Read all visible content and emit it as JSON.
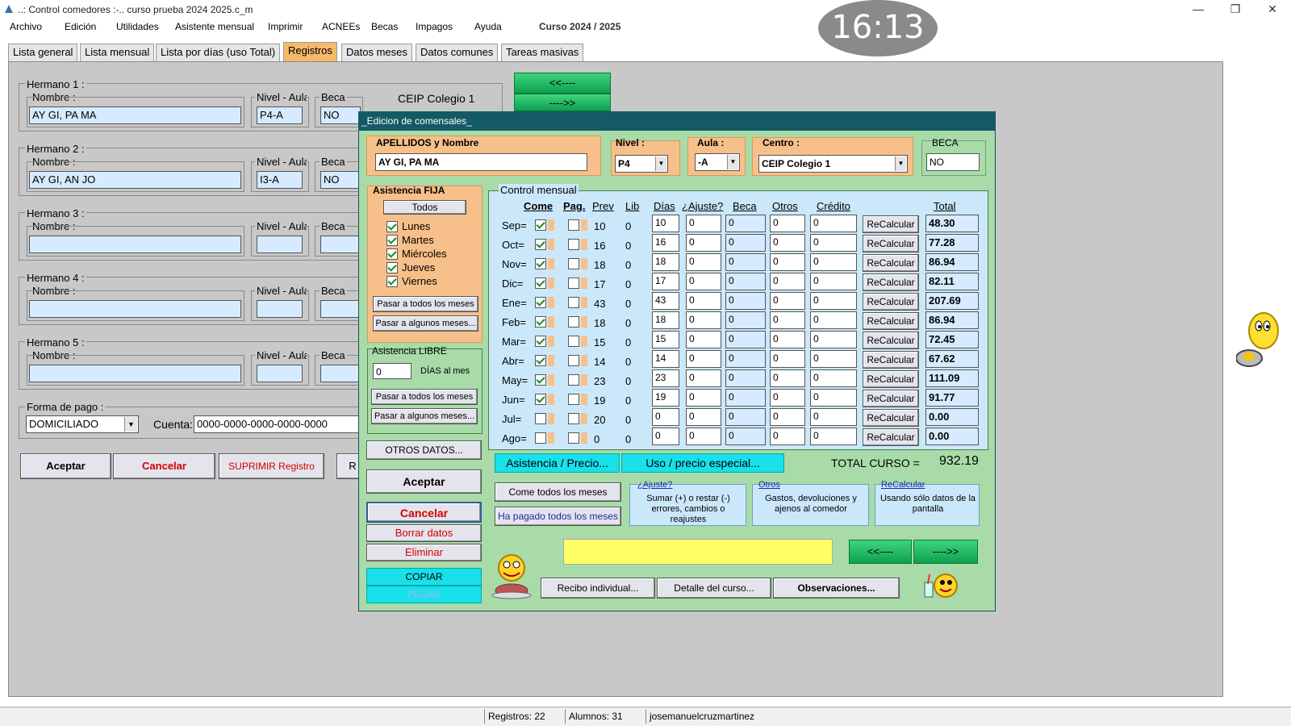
{
  "window": {
    "title": "..: Control comedores :-..   curso prueba 2024 2025.c_m",
    "min": "—",
    "max": "❐",
    "close": "✕"
  },
  "menu": [
    "Archivo",
    "Edición",
    "Utilidades",
    "Asistente mensual",
    "Imprimir",
    "ACNEEs",
    "Becas",
    "Impagos",
    "Ayuda"
  ],
  "curso": "Curso 2024 / 2025",
  "clock": "16:13",
  "tabs": [
    "Lista general",
    "Lista mensual",
    "Lista por días (uso Total)",
    "Registros",
    "Datos meses",
    "Datos comunes",
    "Tareas masivas"
  ],
  "main": {
    "hermanos": [
      {
        "label": "Hermano 1 :",
        "nombre_label": "Nombre :",
        "nombre": "AY GI, PA MA",
        "nivel_label": "Nivel - Aula",
        "nivel": "P4-A",
        "beca_label": "Beca",
        "beca": "NO"
      },
      {
        "label": "Hermano 2 :",
        "nombre_label": "Nombre :",
        "nombre": "AY GI, AN JO",
        "nivel_label": "Nivel - Aula",
        "nivel": "I3-A",
        "beca_label": "Beca",
        "beca": "NO"
      },
      {
        "label": "Hermano 3 :",
        "nombre_label": "Nombre :",
        "nombre": "",
        "nivel_label": "Nivel - Aula",
        "nivel": "",
        "beca_label": "Beca",
        "beca": ""
      },
      {
        "label": "Hermano 4 :",
        "nombre_label": "Nombre :",
        "nombre": "",
        "nivel_label": "Nivel - Aula",
        "nivel": "",
        "beca_label": "Beca",
        "beca": ""
      },
      {
        "label": "Hermano 5 :",
        "nombre_label": "Nombre :",
        "nombre": "",
        "nivel_label": "Nivel - Aula",
        "nivel": "",
        "beca_label": "Beca",
        "beca": ""
      }
    ],
    "centro": "CEIP Colegio 1",
    "forma_pago_label": "Forma de pago :",
    "forma_pago": "DOMICILIADO",
    "cuenta_label": "Cuenta:",
    "cuenta": "0000-0000-0000-0000-0000",
    "prev_btn": "<<----",
    "next_btn": "---->>",
    "aceptar": "Aceptar",
    "cancelar": "Cancelar",
    "suprimir": "SUPRIMIR   Registro",
    "extra_btn": "R"
  },
  "dialog": {
    "title": "_Edicion de comensales_",
    "apellidos_label": "APELLIDOS  y Nombre",
    "apellidos": "AY GI, PA MA",
    "nivel_label": "Nivel  :",
    "nivel": "P4",
    "aula_label": "Aula :",
    "aula": "-A",
    "centro_label": "Centro :",
    "centro": "CEIP Colegio 1",
    "beca_label": "BECA",
    "beca": "NO",
    "asistencia_fija": "Asistencia FIJA",
    "todos": "Todos",
    "dias": [
      {
        "name": "Lunes",
        "on": true
      },
      {
        "name": "Martes",
        "on": true
      },
      {
        "name": "Miércoles",
        "on": true
      },
      {
        "name": "Jueves",
        "on": true
      },
      {
        "name": "Viernes",
        "on": true
      }
    ],
    "pasar_todos": "Pasar a todos los meses",
    "pasar_algunos": "Pasar a algunos meses...",
    "asistencia_libre": "Asistencia LIBRE",
    "libre_valor": "0",
    "dias_al_mes": "DÍAS al mes",
    "otros_datos": "OTROS DATOS...",
    "aceptar": "Aceptar",
    "cancelar": "Cancelar",
    "borrar": "Borrar datos",
    "eliminar": "Eliminar",
    "copiar": "COPIAR",
    "pegar": "PEGAR",
    "control_mensual": "Control mensual",
    "headers": {
      "come": "Come",
      "pag": "Pag.",
      "prev": "Prev",
      "lib": "Lib",
      "dias": "Días",
      "ajuste": "¿Ajuste?",
      "beca": "Beca",
      "otros": "Otros",
      "credito": "Crédito",
      "total": "Total"
    },
    "recalcular": "ReCalcular",
    "months": [
      {
        "m": "Sep=",
        "come": true,
        "prev": "10",
        "lib": "0",
        "dias": "10",
        "ajuste": "0",
        "beca": "0",
        "otros": "0",
        "credito": "0",
        "total": "48.30"
      },
      {
        "m": "Oct=",
        "come": true,
        "prev": "16",
        "lib": "0",
        "dias": "16",
        "ajuste": "0",
        "beca": "0",
        "otros": "0",
        "credito": "0",
        "total": "77.28"
      },
      {
        "m": "Nov=",
        "come": true,
        "prev": "18",
        "lib": "0",
        "dias": "18",
        "ajuste": "0",
        "beca": "0",
        "otros": "0",
        "credito": "0",
        "total": "86.94"
      },
      {
        "m": "Dic=",
        "come": true,
        "prev": "17",
        "lib": "0",
        "dias": "17",
        "ajuste": "0",
        "beca": "0",
        "otros": "0",
        "credito": "0",
        "total": "82.11"
      },
      {
        "m": "Ene=",
        "come": true,
        "prev": "43",
        "lib": "0",
        "dias": "43",
        "ajuste": "0",
        "beca": "0",
        "otros": "0",
        "credito": "0",
        "total": "207.69"
      },
      {
        "m": "Feb=",
        "come": true,
        "prev": "18",
        "lib": "0",
        "dias": "18",
        "ajuste": "0",
        "beca": "0",
        "otros": "0",
        "credito": "0",
        "total": "86.94"
      },
      {
        "m": "Mar=",
        "come": true,
        "prev": "15",
        "lib": "0",
        "dias": "15",
        "ajuste": "0",
        "beca": "0",
        "otros": "0",
        "credito": "0",
        "total": "72.45"
      },
      {
        "m": "Abr=",
        "come": true,
        "prev": "14",
        "lib": "0",
        "dias": "14",
        "ajuste": "0",
        "beca": "0",
        "otros": "0",
        "credito": "0",
        "total": "67.62"
      },
      {
        "m": "May=",
        "come": true,
        "prev": "23",
        "lib": "0",
        "dias": "23",
        "ajuste": "0",
        "beca": "0",
        "otros": "0",
        "credito": "0",
        "total": "111.09"
      },
      {
        "m": "Jun=",
        "come": true,
        "prev": "19",
        "lib": "0",
        "dias": "19",
        "ajuste": "0",
        "beca": "0",
        "otros": "0",
        "credito": "0",
        "total": "91.77"
      },
      {
        "m": "Jul=",
        "come": false,
        "prev": "20",
        "lib": "0",
        "dias": "0",
        "ajuste": "0",
        "beca": "0",
        "otros": "0",
        "credito": "0",
        "total": "0.00"
      },
      {
        "m": "Ago=",
        "come": false,
        "prev": "0",
        "lib": "0",
        "dias": "0",
        "ajuste": "0",
        "beca": "0",
        "otros": "0",
        "credito": "0",
        "total": "0.00"
      }
    ],
    "asistencia_precio": "Asistencia / Precio...",
    "uso_precio": "Uso / precio especial...",
    "total_curso_label": "TOTAL CURSO =",
    "total_curso": "932.19",
    "come_todos": "Come todos los meses",
    "ha_pagado": "Ha pagado todos los meses",
    "info_ajuste_title": "¿Ajuste?",
    "info_ajuste": "Sumar (+) o restar (-) errores, cambios o reajustes",
    "info_otros_title": "Otros",
    "info_otros": "Gastos, devoluciones y ajenos al comedor",
    "info_recalc_title": "ReCalcular",
    "info_recalc": "Usando sólo datos de la pantalla",
    "prev_btn": "<<----",
    "next_btn": "---->>",
    "recibo": "Recibo individual...",
    "detalle": "Detalle del curso...",
    "observaciones": "Observaciones..."
  },
  "status": {
    "registros": "Registros: 22",
    "alumnos": "Alumnos: 31",
    "user": "josemanuelcruzmartinez"
  }
}
